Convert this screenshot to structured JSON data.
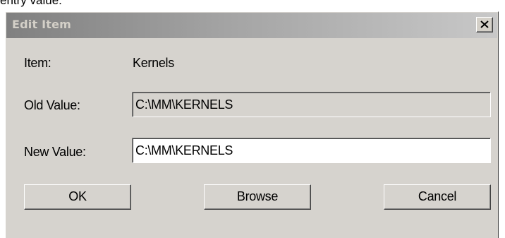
{
  "context": {
    "fragment": "entry value."
  },
  "dialog": {
    "title": "Edit Item",
    "close_icon": "close-x-icon",
    "fields": {
      "item_label": "Item:",
      "item_value": "Kernels",
      "old_value_label": "Old Value:",
      "old_value": "C:\\MM\\KERNELS",
      "new_value_label": "New Value:",
      "new_value": "C:\\MM\\KERNELS"
    },
    "buttons": {
      "ok": "OK",
      "browse": "Browse",
      "cancel": "Cancel"
    }
  },
  "colors": {
    "face": "#d6d3ce",
    "title_gradient_start": "#808080",
    "title_gradient_end": "#c8c8c8"
  }
}
